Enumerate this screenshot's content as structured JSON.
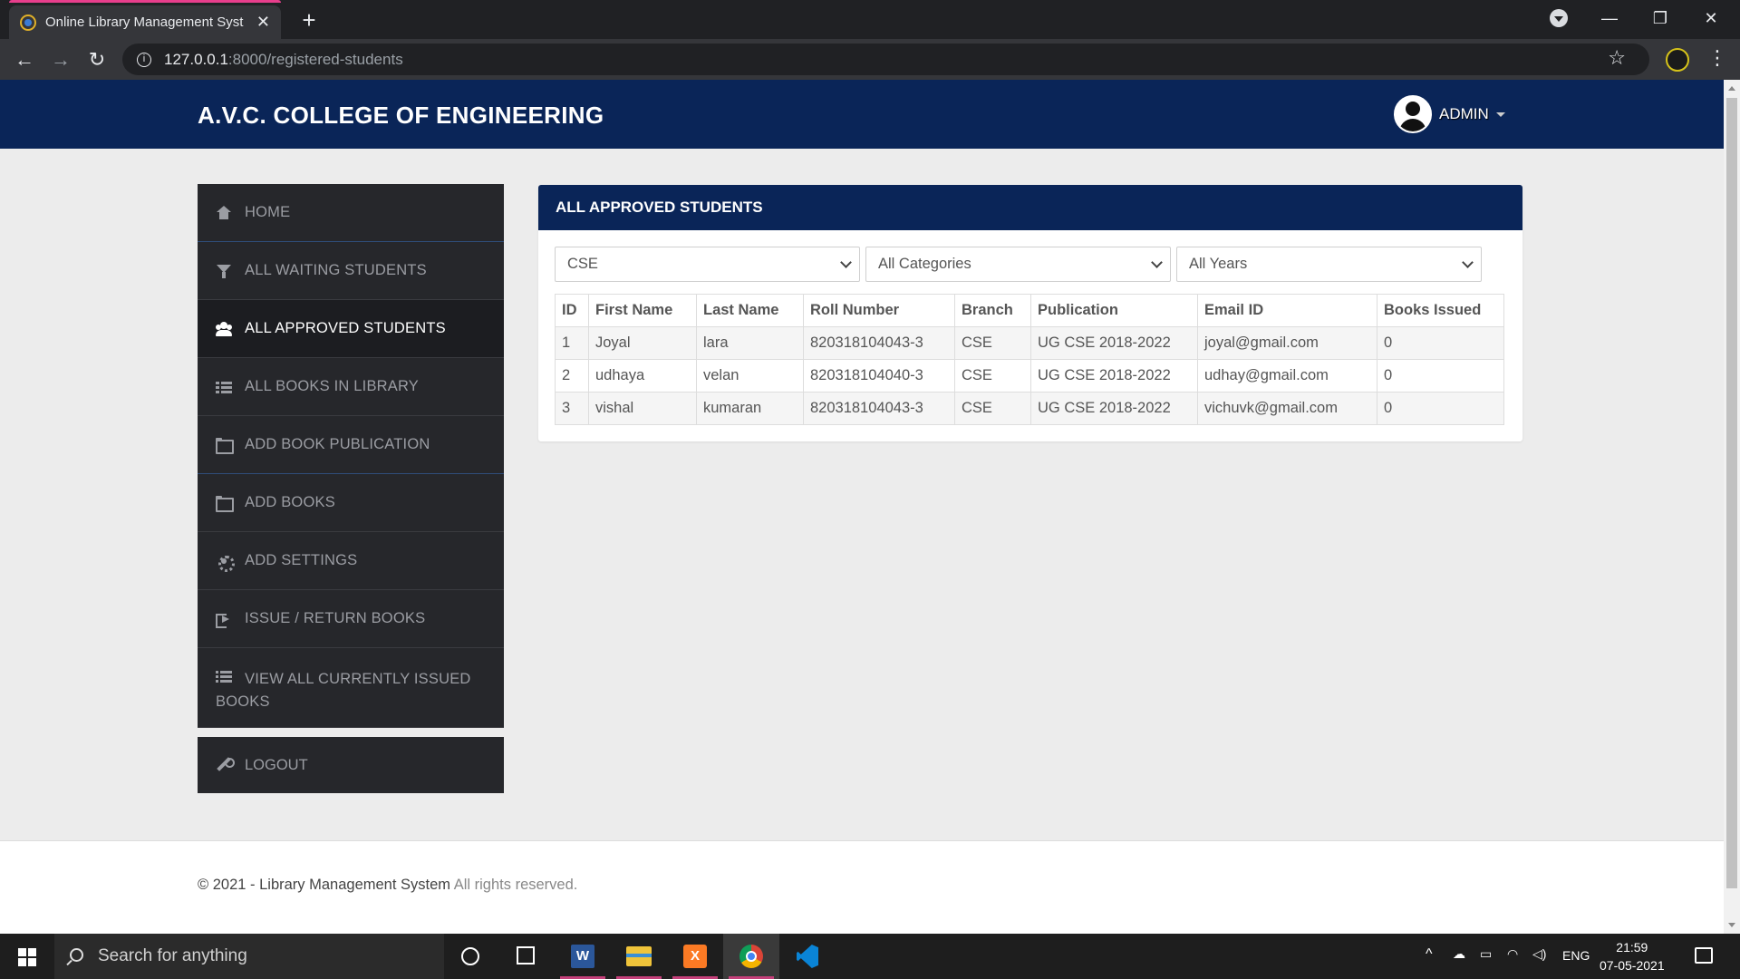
{
  "browser": {
    "tab_title": "Online Library Management Syst",
    "tab_close": "✕",
    "new_tab": "+",
    "url_host": "127.0.0.1",
    "url_path": ":8000/registered-students",
    "back": "←",
    "forward": "→",
    "reload": "↻",
    "star": "☆",
    "menu": "⋮",
    "minimize": "—",
    "restore": "❐",
    "close": "✕"
  },
  "header": {
    "brand": "A.V.C. COLLEGE OF ENGINEERING",
    "user_label": "ADMIN"
  },
  "sidebar": {
    "items": [
      {
        "label": "HOME",
        "icon": "home-icon"
      },
      {
        "label": "ALL WAITING STUDENTS",
        "icon": "filter-icon"
      },
      {
        "label": "ALL APPROVED STUDENTS",
        "icon": "users-icon",
        "active": true
      },
      {
        "label": "ALL BOOKS IN LIBRARY",
        "icon": "list-icon"
      },
      {
        "label": "ADD BOOK PUBLICATION",
        "icon": "folder-icon"
      },
      {
        "label": "ADD BOOKS",
        "icon": "folder-icon"
      },
      {
        "label": "ADD SETTINGS",
        "icon": "gear-icon"
      },
      {
        "label": "ISSUE / RETURN BOOKS",
        "icon": "sign-out-icon"
      },
      {
        "label_line1": "VIEW ALL CURRENTLY ISSUED",
        "label_line2": "BOOKS",
        "icon": "tasks-icon"
      }
    ],
    "logout": {
      "label": "LOGOUT",
      "icon": "wrench-icon"
    }
  },
  "panel": {
    "title": "ALL APPROVED STUDENTS",
    "filters": {
      "branch": "CSE",
      "category": "All Categories",
      "year": "All Years"
    },
    "table": {
      "columns": [
        "ID",
        "First Name",
        "Last Name",
        "Roll Number",
        "Branch",
        "Publication",
        "Email ID",
        "Books Issued"
      ],
      "rows": [
        [
          "1",
          "Joyal",
          "lara",
          "820318104043-3",
          "CSE",
          "UG CSE 2018-2022",
          "joyal@gmail.com",
          "0"
        ],
        [
          "2",
          "udhaya",
          "velan",
          "820318104040-3",
          "CSE",
          "UG CSE 2018-2022",
          "udhay@gmail.com",
          "0"
        ],
        [
          "3",
          "vishal",
          "kumaran",
          "820318104043-3",
          "CSE",
          "UG CSE 2018-2022",
          "vichuvk@gmail.com",
          "0"
        ]
      ]
    }
  },
  "footer": {
    "strong": "© 2021 - Library Management System",
    "rest": " All rights reserved."
  },
  "taskbar": {
    "search_placeholder": "Search for anything",
    "lang": "ENG",
    "time": "21:59",
    "date": "07-05-2021"
  },
  "colors": {
    "navy": "#0a2558",
    "sidebar": "#26272b",
    "taskbar": "#1e1e1e"
  }
}
